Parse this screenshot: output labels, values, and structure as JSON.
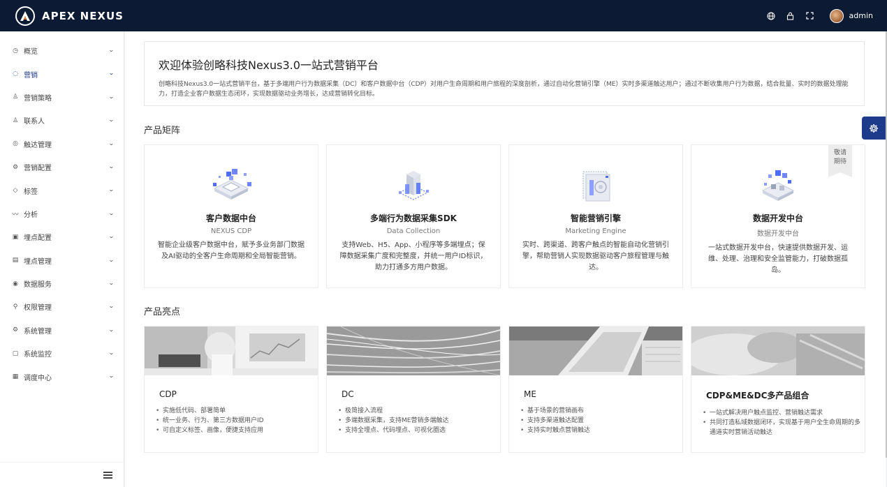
{
  "header": {
    "brand": "APEX NEXUS",
    "username": "admin"
  },
  "sidebar": {
    "items": [
      {
        "label": "概览",
        "icon": "clock-icon",
        "active": false
      },
      {
        "label": "营销",
        "icon": "refresh-icon",
        "active": true
      },
      {
        "label": "营销策略",
        "icon": "users-icon",
        "active": false
      },
      {
        "label": "联系人",
        "icon": "contact-icon",
        "active": false
      },
      {
        "label": "触达管理",
        "icon": "target-icon",
        "active": false
      },
      {
        "label": "营销配置",
        "icon": "settings-icon",
        "active": false
      },
      {
        "label": "标签",
        "icon": "tag-icon",
        "active": false
      },
      {
        "label": "分析",
        "icon": "chart-icon",
        "active": false
      },
      {
        "label": "埋点配置",
        "icon": "config-icon",
        "active": false
      },
      {
        "label": "埋点管理",
        "icon": "document-icon",
        "active": false
      },
      {
        "label": "数据服务",
        "icon": "database-icon",
        "active": false
      },
      {
        "label": "权限管理",
        "icon": "permission-icon",
        "active": false
      },
      {
        "label": "系统管理",
        "icon": "gear-icon",
        "active": false
      },
      {
        "label": "系统监控",
        "icon": "monitor-icon",
        "active": false
      },
      {
        "label": "调度中心",
        "icon": "schedule-icon",
        "active": false
      }
    ]
  },
  "welcome": {
    "title": "欢迎体验创略科技Nexus3.0一站式营销平台",
    "description": "创略科技Nexus3.0一站式营销平台，基于多端用户行为数据采集（DC）和客户数据中台（CDP）对用户生命周期和用户旅程的深度剖析，通过自动化营销引擎（ME）实时多渠道触达用户；通过不断收集用户行为数据，结合批量、实时的数据处理能力，打造企业客户数据生态闭环，实现数据驱动业务增长，达成营销转化目标。"
  },
  "products": {
    "section_title": "产品矩阵",
    "items": [
      {
        "title": "客户数据中台",
        "subtitle": "NEXUS CDP",
        "description": "智能企业级客户数据中台，赋予多业务部门数据及AI驱动的全客户生命周期和全局智能营销。",
        "badge": ""
      },
      {
        "title": "多端行为数据采集SDK",
        "subtitle": "Data Collection",
        "description": "支持Web、H5、App、小程序等多端埋点；保障数据采集广度和完整度，并统一用户ID标识，助力打通多方用户数据。",
        "badge": ""
      },
      {
        "title": "智能营销引擎",
        "subtitle": "Marketing Engine",
        "description": "实时、跨渠道、跨客户触点的智能自动化营销引擎，帮助营销人实现数据驱动客户旅程管理与触达。",
        "badge": ""
      },
      {
        "title": "数据开发中台",
        "subtitle": "数据开发中台",
        "description": "一站式数据开发中台，快速提供数据开发、运维、处理、治理和安全监管能力，打破数据孤岛。",
        "badge": "敬请期待"
      }
    ]
  },
  "highlights": {
    "section_title": "产品亮点",
    "items": [
      {
        "title": "CDP",
        "points": [
          "实施低代码、部署简单",
          "统一业务、行为、第三方数据用户ID",
          "可自定义标签、画像，便捷支持应用"
        ]
      },
      {
        "title": "DC",
        "points": [
          "极简接入流程",
          "多端数据采集，支持ME营销多端触达",
          "支持全埋点、代码埋点、可视化圈选"
        ]
      },
      {
        "title": "ME",
        "points": [
          "基于场景的营销画布",
          "支持多渠道触达配置",
          "支持实时触点营销触达"
        ]
      },
      {
        "title": "CDP&ME&DC多产品组合",
        "points": [
          "一站式解决用户触点监控、营销触达需求",
          "共同打造私域数据闭环，实现基于用户全生命周期的多通道实时营销活动触达"
        ]
      }
    ]
  },
  "colors": {
    "header_bg": "#0c1b33",
    "accent": "#1e3a8a",
    "illustration_blue": "#4f6ef7"
  }
}
